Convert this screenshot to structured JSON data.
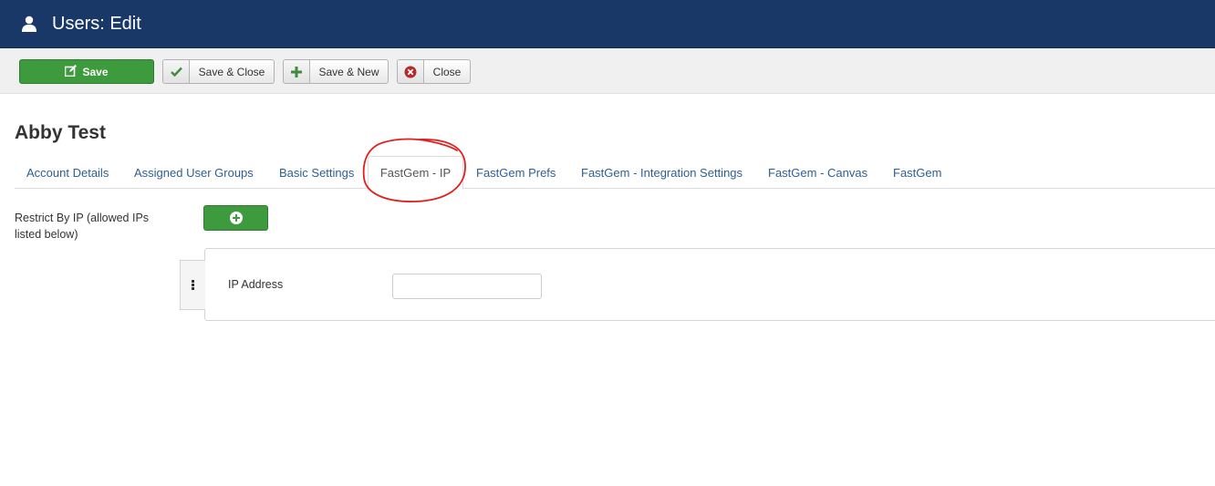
{
  "header": {
    "title": "Users: Edit",
    "icon": "user-icon",
    "background": "#1a3867"
  },
  "toolbar": {
    "save_label": "Save",
    "save_close_label": "Save & Close",
    "save_new_label": "Save & New",
    "close_label": "Close",
    "save_color": "#3d9b3d"
  },
  "page": {
    "title": "Abby Test"
  },
  "tabs": [
    {
      "label": "Account Details",
      "active": false
    },
    {
      "label": "Assigned User Groups",
      "active": false
    },
    {
      "label": "Basic Settings",
      "active": false
    },
    {
      "label": "FastGem - IP",
      "active": true
    },
    {
      "label": "FastGem Prefs",
      "active": false
    },
    {
      "label": "FastGem - Integration Settings",
      "active": false
    },
    {
      "label": "FastGem - Canvas",
      "active": false
    },
    {
      "label": "FastGem",
      "active": false
    }
  ],
  "form": {
    "restrict_label": "Restrict By IP (allowed IPs listed below)",
    "ip_address_label": "IP Address",
    "ip_address_value": "",
    "ip_address_placeholder": ""
  },
  "annotation": {
    "highlight_color": "#e02020"
  }
}
